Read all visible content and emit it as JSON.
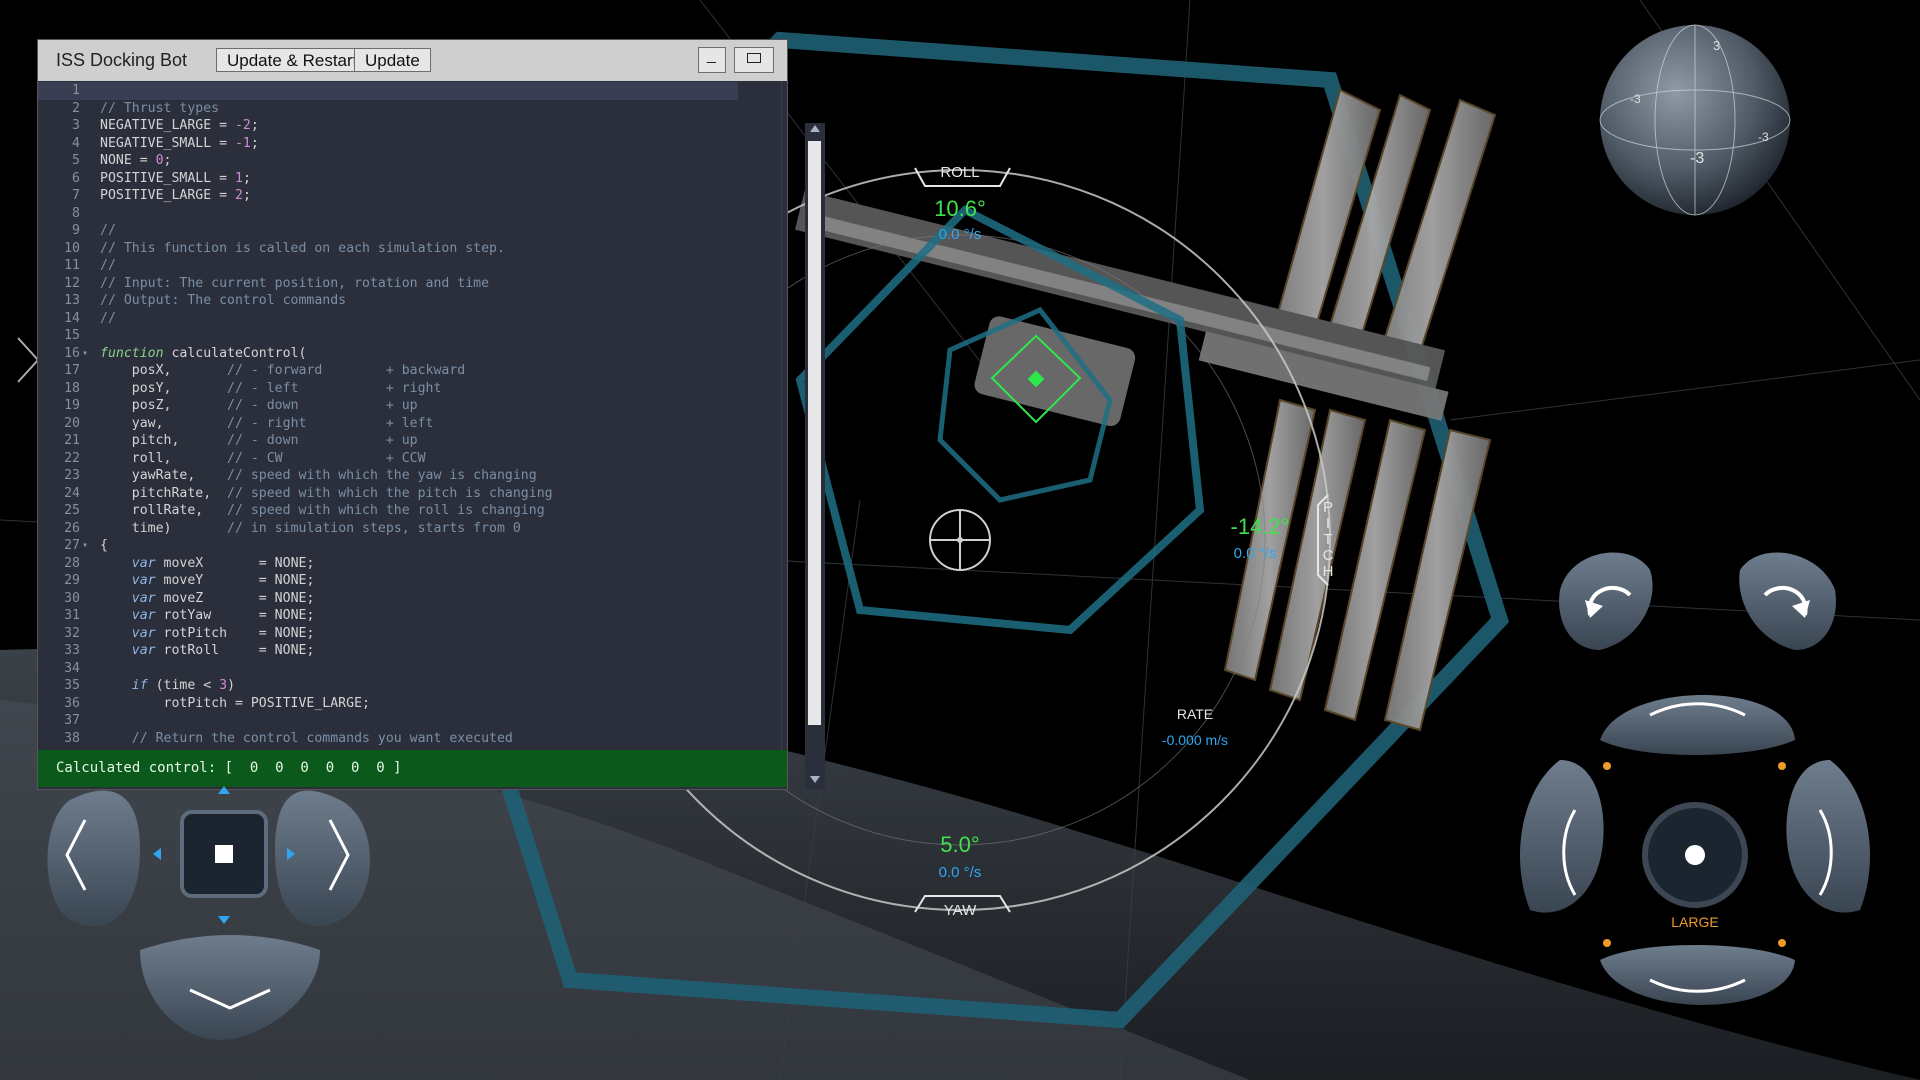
{
  "editor": {
    "title": "ISS Docking Bot",
    "buttons": {
      "update_restart": "Update & Restart",
      "update": "Update"
    },
    "window_controls": {
      "minimize": "_",
      "maximize": "□"
    },
    "lines": [
      {
        "n": "1",
        "t": ""
      },
      {
        "n": "2",
        "t": "// Thrust types"
      },
      {
        "n": "3",
        "t": "NEGATIVE_LARGE = -2;"
      },
      {
        "n": "4",
        "t": "NEGATIVE_SMALL = -1;"
      },
      {
        "n": "5",
        "t": "NONE = 0;"
      },
      {
        "n": "6",
        "t": "POSITIVE_SMALL = 1;"
      },
      {
        "n": "7",
        "t": "POSITIVE_LARGE = 2;"
      },
      {
        "n": "8",
        "t": ""
      },
      {
        "n": "9",
        "t": "//"
      },
      {
        "n": "10",
        "t": "// This function is called on each simulation step."
      },
      {
        "n": "11",
        "t": "//"
      },
      {
        "n": "12",
        "t": "// Input: The current position, rotation and time"
      },
      {
        "n": "13",
        "t": "// Output: The control commands"
      },
      {
        "n": "14",
        "t": "//"
      },
      {
        "n": "15",
        "t": ""
      },
      {
        "n": "16",
        "t": "function calculateControl("
      },
      {
        "n": "17",
        "t": "    posX,       // - forward        + backward"
      },
      {
        "n": "18",
        "t": "    posY,       // - left           + right"
      },
      {
        "n": "19",
        "t": "    posZ,       // - down           + up"
      },
      {
        "n": "20",
        "t": "    yaw,        // - right          + left"
      },
      {
        "n": "21",
        "t": "    pitch,      // - down           + up"
      },
      {
        "n": "22",
        "t": "    roll,       // - CW             + CCW"
      },
      {
        "n": "23",
        "t": "    yawRate,    // speed with which the yaw is changing"
      },
      {
        "n": "24",
        "t": "    pitchRate,  // speed with which the pitch is changing"
      },
      {
        "n": "25",
        "t": "    rollRate,   // speed with which the roll is changing"
      },
      {
        "n": "26",
        "t": "    time)       // in simulation steps, starts from 0"
      },
      {
        "n": "27",
        "t": "{"
      },
      {
        "n": "28",
        "t": "    var moveX       = NONE;"
      },
      {
        "n": "29",
        "t": "    var moveY       = NONE;"
      },
      {
        "n": "30",
        "t": "    var moveZ       = NONE;"
      },
      {
        "n": "31",
        "t": "    var rotYaw      = NONE;"
      },
      {
        "n": "32",
        "t": "    var rotPitch    = NONE;"
      },
      {
        "n": "33",
        "t": "    var rotRoll     = NONE;"
      },
      {
        "n": "34",
        "t": ""
      },
      {
        "n": "35",
        "t": "    if (time < 3)"
      },
      {
        "n": "36",
        "t": "        rotPitch = POSITIVE_LARGE;"
      },
      {
        "n": "37",
        "t": ""
      },
      {
        "n": "38",
        "t": "    // Return the control commands you want executed"
      }
    ],
    "status": "Calculated control: [  0  0  0  0  0  0 ]"
  },
  "hud": {
    "roll": {
      "label": "ROLL",
      "angle": "10.6°",
      "rate": "0.0 °/s"
    },
    "pitch": {
      "label": "PITCH",
      "angle": "-14.2°",
      "rate": "0.0 °/s"
    },
    "yaw": {
      "label": "YAW",
      "angle": "5.0°",
      "rate": "0.0 °/s"
    },
    "rate": {
      "label": "RATE",
      "value": "-0.000 m/s"
    },
    "sphere_ticks": [
      "3",
      "-3",
      "-3",
      "-3"
    ]
  },
  "controls": {
    "translation_size_label": "LARGE",
    "accent_colors": {
      "green": "#3fe14c",
      "blue": "#2fa7f0",
      "orange": "#f09a2a",
      "hud_teal": "#1f6f86"
    }
  }
}
